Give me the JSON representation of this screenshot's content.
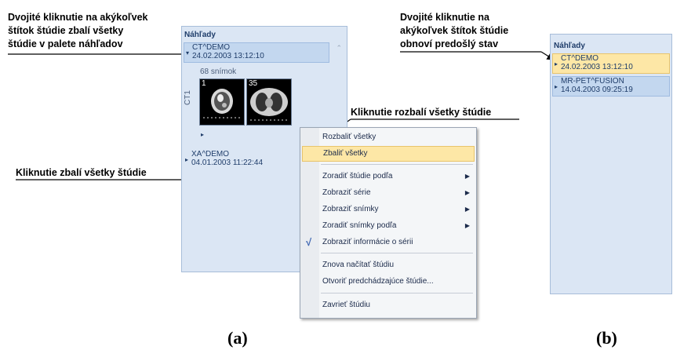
{
  "annotations": {
    "top_left": [
      "Dvojité kliknutie na akýkoľvek",
      "štítok štúdie zbalí všetky",
      "štúdie v palete náhľadov"
    ],
    "click_expand": "Kliknutie rozbalí všetky štúdie",
    "click_collapse": "Kliknutie zbalí všetky štúdie",
    "top_right": [
      "Dvojité kliknutie na",
      "akýkoľvek štítok štúdie",
      "obnoví predošlý stav"
    ]
  },
  "panel_a": {
    "title": "Náhľady",
    "studies": [
      {
        "name": "CT^DEMO",
        "date": "24.02.2003 13:12:10"
      },
      {
        "name": "XA^DEMO",
        "date": "04.01.2003 11:22:44"
      }
    ],
    "series_count": "68 snímok",
    "series_label": "CT1",
    "thumbs": [
      "1",
      "35"
    ]
  },
  "menu": {
    "items": [
      "Rozbaliť všetky",
      "Zbaliť všetky",
      "Zoradiť štúdie podľa",
      "Zobraziť série",
      "Zobraziť snímky",
      "Zoradiť snímky podľa",
      "Zobraziť informácie o sérii",
      "Znova načítať štúdiu",
      "Otvoriť predchádzajúce štúdie...",
      "Zavrieť štúdiu"
    ],
    "check_glyph": "√"
  },
  "panel_b": {
    "title": "Náhľady",
    "studies": [
      {
        "name": "CT^DEMO",
        "date": "24.02.2003 13:12:10"
      },
      {
        "name": "MR-PET^FUSION",
        "date": "14.04.2003 09:25:19"
      }
    ]
  },
  "captions": {
    "a": "(a)",
    "b": "(b)"
  },
  "colors": {
    "panel_bg": "#dbe6f4",
    "highlight": "#fde7a6",
    "selected": "#c3d7ef"
  }
}
